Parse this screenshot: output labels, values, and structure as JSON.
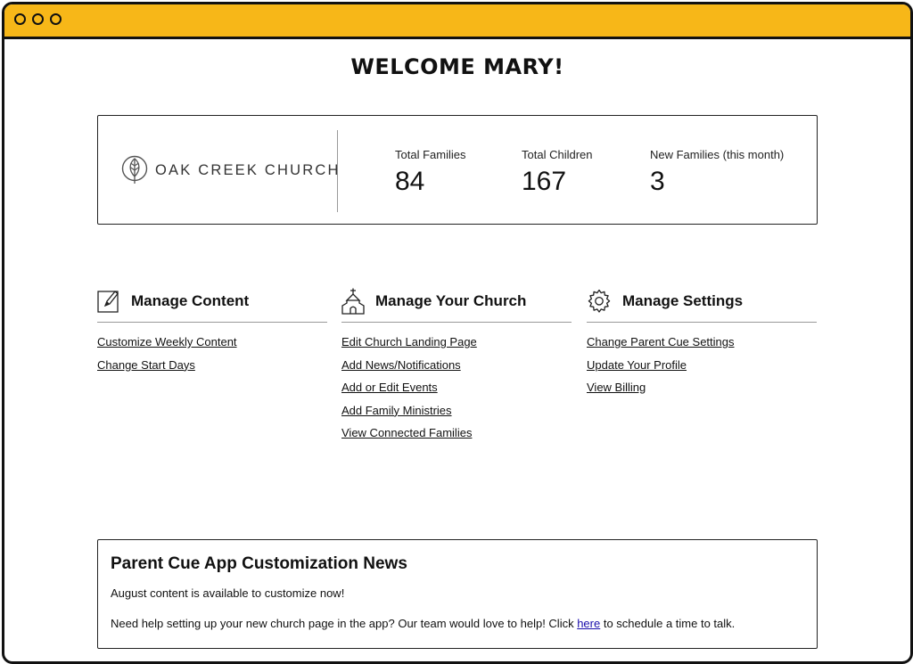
{
  "heading": "WELCOME MARY!",
  "brand": {
    "name": "OAK CREEK CHURCH",
    "logo_icon": "tree-leaf-icon"
  },
  "stats": [
    {
      "label": "Total Families",
      "value": "84"
    },
    {
      "label": "Total Children",
      "value": "167"
    },
    {
      "label": "New Families (this month)",
      "value": "3"
    }
  ],
  "sections": [
    {
      "title": "Manage Content",
      "icon": "edit-icon",
      "links": [
        "Customize Weekly Content",
        "Change Start Days"
      ]
    },
    {
      "title": "Manage Your Church",
      "icon": "church-icon",
      "links": [
        "Edit Church Landing Page",
        "Add News/Notifications",
        "Add or Edit Events",
        "Add Family Ministries",
        "View Connected Families"
      ]
    },
    {
      "title": "Manage Settings",
      "icon": "gear-icon",
      "links": [
        "Change Parent Cue Settings",
        "Update Your Profile",
        "View Billing"
      ]
    }
  ],
  "news": {
    "title": "Parent Cue App Customization News",
    "line1": "August content is available to customize now!",
    "line2_before": "Need help setting up your new church page in the app? Our team would love to help! Click ",
    "line2_link": "here",
    "line2_after": " to schedule a time to talk."
  },
  "colors": {
    "titlebar": "#f7b718",
    "link": "#1a0dab"
  }
}
